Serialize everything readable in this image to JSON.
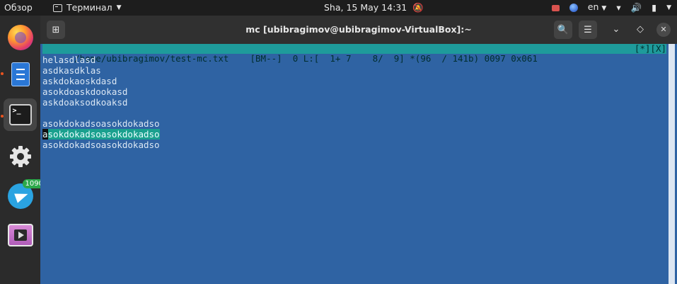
{
  "topbar": {
    "overview": "Обзор",
    "app_name": "Терминал",
    "clock": "Sha, 15 May 14:31",
    "language": "en"
  },
  "dock": {
    "telegram_badge": "1090"
  },
  "window": {
    "title": "mc [ubibragimov@ubibragimov-VirtualBox]:~"
  },
  "editor": {
    "status_left": "/home/ubibragimov/test-mc.txt    [BM--]  0 L:[  1+ 7    8/  9] *(96  / 141b) 0097 0x061",
    "status_right": "[*][X]",
    "lines": [
      "helasdlasd",
      "asdkasdklas",
      "askdokaoskdasd",
      "asokdoaskdookasd",
      "askdoaksodkoaksd",
      "",
      "asokdokadsoasokdokadso",
      "asokdokadsoasokdokadso",
      "asokdokadsoasokdokadso"
    ],
    "cursor_char": "a",
    "selected_rest": "sokdokadsoasokdokadso"
  },
  "colors": {
    "editor_bg": "#2f63a3",
    "status_bg": "#1e9b9b",
    "selection": "#1aa08e"
  }
}
